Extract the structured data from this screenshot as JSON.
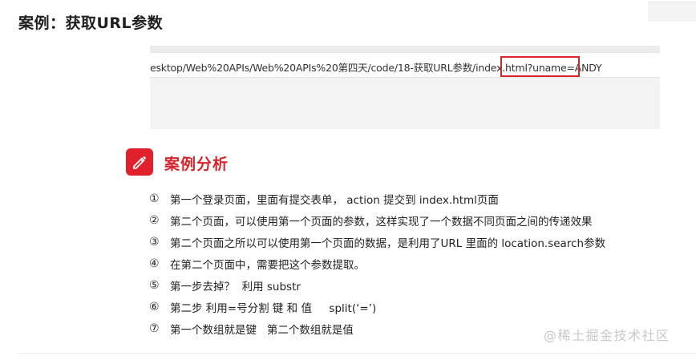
{
  "page": {
    "title": "案例：获取URL参数"
  },
  "browser": {
    "url_path": "esktop/Web%20APIs/Web%20APIs%20第四天/code/18-获取URL参数/index.html?",
    "url_query": "uname=ANDY",
    "highlight_color": "#d9242c"
  },
  "section": {
    "icon": "pencil-icon",
    "title": "案例分析",
    "accent_color": "#e0202a"
  },
  "steps": [
    {
      "num": "①",
      "text": "第一个登录页面，里面有提交表单， action 提交到 index.html页面"
    },
    {
      "num": "②",
      "text": "第二个页面，可以使用第一个页面的参数，这样实现了一个数据不同页面之间的传递效果"
    },
    {
      "num": "③",
      "text": "第二个页面之所以可以使用第一个页面的数据，是利用了URL 里面的 location.search参数"
    },
    {
      "num": "④",
      "text": "在第二个页面中，需要把这个参数提取。"
    },
    {
      "num": "⑤",
      "text": "第一步去掉？  利用 substr"
    },
    {
      "num": "⑥",
      "text": "第二步 利用=号分割 键 和 值     split(‘=’)"
    },
    {
      "num": "⑦",
      "text": "第一个数组就是键   第二个数组就是值"
    }
  ],
  "watermark": "@稀土掘金技术社区"
}
